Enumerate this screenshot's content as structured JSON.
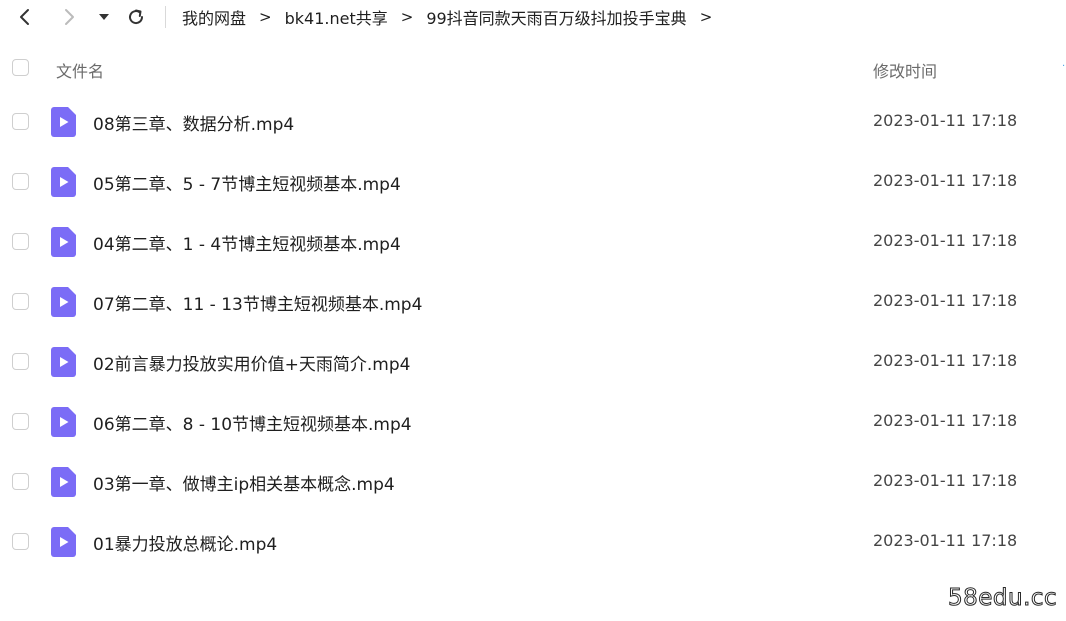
{
  "toolbar": {
    "back_icon": "chevron-left-icon",
    "forward_icon": "chevron-right-icon",
    "history_icon": "caret-down-icon",
    "refresh_icon": "refresh-icon"
  },
  "breadcrumb": {
    "items": [
      "我的网盘",
      "bk41.net共享",
      "99抖音同款天雨百万级抖加投手宝典"
    ],
    "separator": ">"
  },
  "columns": {
    "name": "文件名",
    "modified": "修改时间"
  },
  "files": [
    {
      "name": "08第三章、数据分析.mp4",
      "modified": "2023-01-11 17:18",
      "icon": "video-file-icon"
    },
    {
      "name": "05第二章、5 - 7节博主短视频基本.mp4",
      "modified": "2023-01-11 17:18",
      "icon": "video-file-icon"
    },
    {
      "name": "04第二章、1 - 4节博主短视频基本.mp4",
      "modified": "2023-01-11 17:18",
      "icon": "video-file-icon"
    },
    {
      "name": "07第二章、11 - 13节博主短视频基本.mp4",
      "modified": "2023-01-11 17:18",
      "icon": "video-file-icon"
    },
    {
      "name": "02前言暴力投放实用价值+天雨简介.mp4",
      "modified": "2023-01-11 17:18",
      "icon": "video-file-icon"
    },
    {
      "name": "06第二章、8 - 10节博主短视频基本.mp4",
      "modified": "2023-01-11 17:18",
      "icon": "video-file-icon"
    },
    {
      "name": "03第一章、做博主ip相关基本概念.mp4",
      "modified": "2023-01-11 17:18",
      "icon": "video-file-icon"
    },
    {
      "name": "01暴力投放总概论.mp4",
      "modified": "2023-01-11 17:18",
      "icon": "video-file-icon"
    }
  ],
  "colors": {
    "icon_accent": "#7b6cf6",
    "text": "#1f1f1f",
    "muted": "#6b6b6b"
  },
  "watermark": "58edu.cc"
}
